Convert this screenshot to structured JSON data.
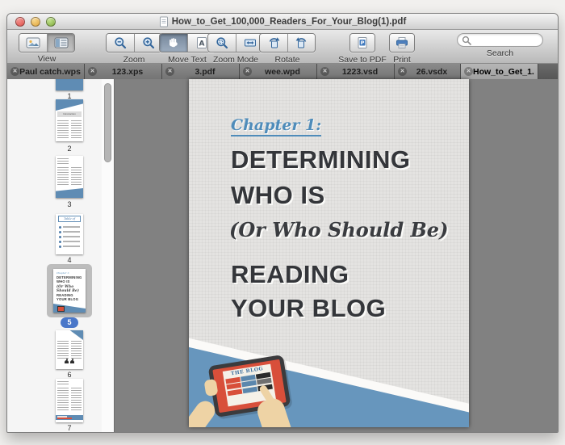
{
  "window": {
    "title": "How_to_Get_100,000_Readers_For_Your_Blog(1).pdf"
  },
  "toolbar": {
    "view": "View",
    "zoom": "Zoom",
    "move_text": "Move Text",
    "zoom_mode": "Zoom Mode",
    "rotate": "Rotate",
    "save_to_pdf": "Save to PDF",
    "print": "Print",
    "search": "Search",
    "search_value": ""
  },
  "tabs": [
    {
      "label": "Paul catch.wps",
      "active": false
    },
    {
      "label": "123.xps",
      "active": false
    },
    {
      "label": "3.pdf",
      "active": false
    },
    {
      "label": "wee.wpd",
      "active": false
    },
    {
      "label": "1223.vsd",
      "active": false
    },
    {
      "label": "26.vsdx",
      "active": false
    },
    {
      "label": "How_to_Get_1...",
      "active": true
    }
  ],
  "sidebar": {
    "pages": [
      {
        "number": "1"
      },
      {
        "number": "2"
      },
      {
        "number": "3"
      },
      {
        "number": "4"
      },
      {
        "number": "5",
        "selected": true
      },
      {
        "number": "6"
      },
      {
        "number": "7"
      }
    ]
  },
  "page": {
    "chapter": "Chapter 1:",
    "heading1": "DETERMINING",
    "heading2": "WHO IS",
    "subheading": "(Or Who Should Be)",
    "heading3": "READING",
    "heading4": "YOUR BLOG",
    "tablet_title": "THE BLOG"
  },
  "thumbnails": {
    "page2_title": "Introduction",
    "page4_title": "Table of Contents"
  },
  "icons": {
    "tab_close": "✕"
  },
  "colors": {
    "accent_blue": "#4f8cba",
    "illustration_blue": "#6796bd",
    "tablet_red": "#d84f3a",
    "badge_blue": "#4a77c9"
  }
}
